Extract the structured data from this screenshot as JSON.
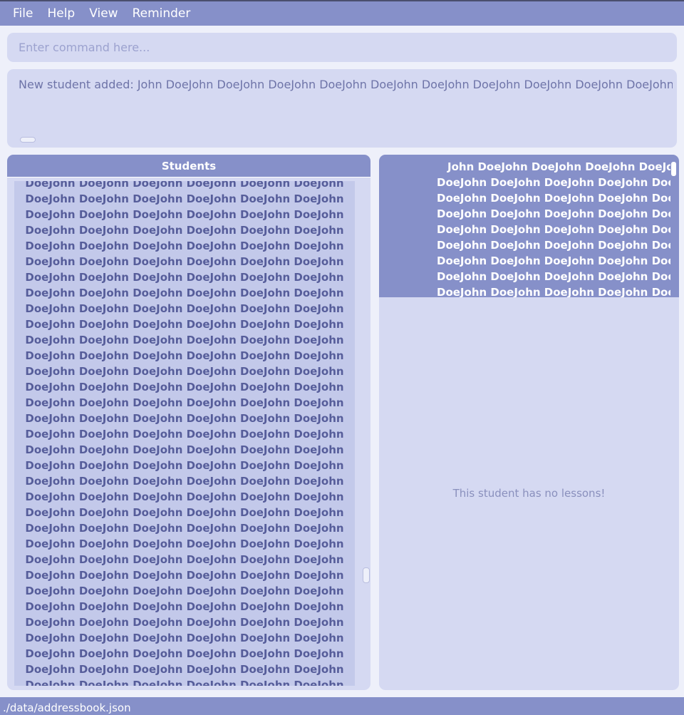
{
  "menu": {
    "items": [
      "File",
      "Help",
      "View",
      "Reminder"
    ]
  },
  "command": {
    "placeholder": "Enter command here..."
  },
  "result": {
    "text": "New student added: John DoeJohn DoeJohn DoeJohn DoeJohn DoeJohn DoeJohn DoeJohn DoeJohn DoeJohn DoeJohn D"
  },
  "students_panel": {
    "header": "Students",
    "line_text": "DoeJohn DoeJohn DoeJohn DoeJohn DoeJohn DoeJohn",
    "visible_line_count": 33
  },
  "detail_panel": {
    "first_line": "John DoeJohn DoeJohn DoeJohn DoeJohn",
    "other_line": "DoeJohn DoeJohn DoeJohn DoeJohn DoeJohn",
    "line_count": 9,
    "no_lessons_text": "This student has no lessons!"
  },
  "status_bar": {
    "path": "./data/addressbook.json"
  },
  "colors": {
    "accent": "#8690c9",
    "panel": "#d5d9f2",
    "list_background": "#c3c9ea",
    "page_background": "#eef0fa",
    "list_text": "#565d9a"
  }
}
